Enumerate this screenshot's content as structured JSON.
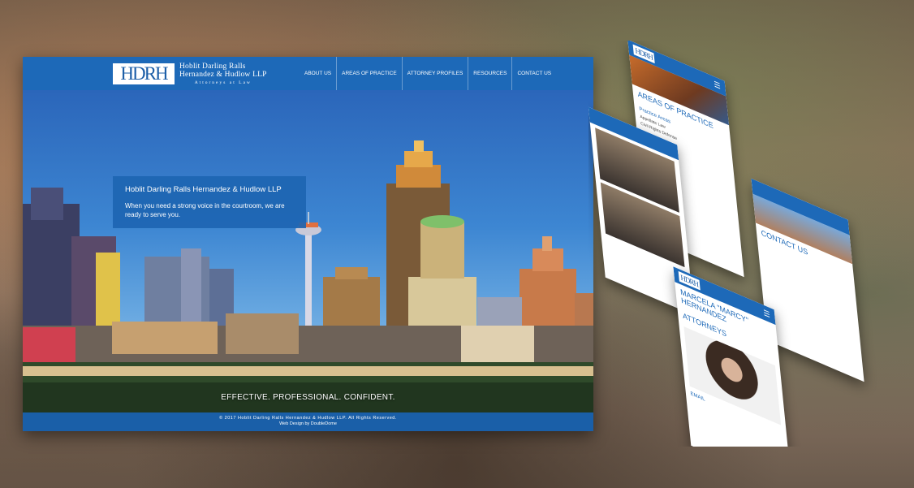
{
  "firm": {
    "logo_mark": "HDRH",
    "name_line1": "Hoblit Darling Ralls",
    "name_line2": "Hernandez & Hudlow LLP",
    "name_line3": "Attorneys at Law"
  },
  "nav": {
    "items": [
      "ABOUT US",
      "AREAS OF PRACTICE",
      "ATTORNEY PROFILES",
      "RESOURCES",
      "CONTACT US"
    ]
  },
  "intro": {
    "title": "Hoblit Darling Ralls Hernandez & Hudlow LLP",
    "subtitle": "When you need a strong voice in the courtroom, we are ready to serve you."
  },
  "tagline": "EFFECTIVE. PROFESSIONAL. CONFIDENT.",
  "footer": {
    "copyright": "© 2017 Hoblit Darling Ralls Hernandez & Hudlow LLP. All Rights Reserved.",
    "credit": "Web Design by DoubleDome"
  },
  "mobile": {
    "practice_heading": "AREAS OF PRACTICE",
    "practice_link": "Practice Areas",
    "practice_items": [
      "Appellate Law",
      "Civil Rights Defense"
    ],
    "contact_heading": "CONTACT US",
    "attorney_name": "MARCELA \"MARCY\" HERNANDEZ",
    "attorneys_heading": "ATTORNEYS",
    "email_link": "EMAIL"
  },
  "colors": {
    "brand_blue": "#1d69b8",
    "white": "#ffffff"
  }
}
